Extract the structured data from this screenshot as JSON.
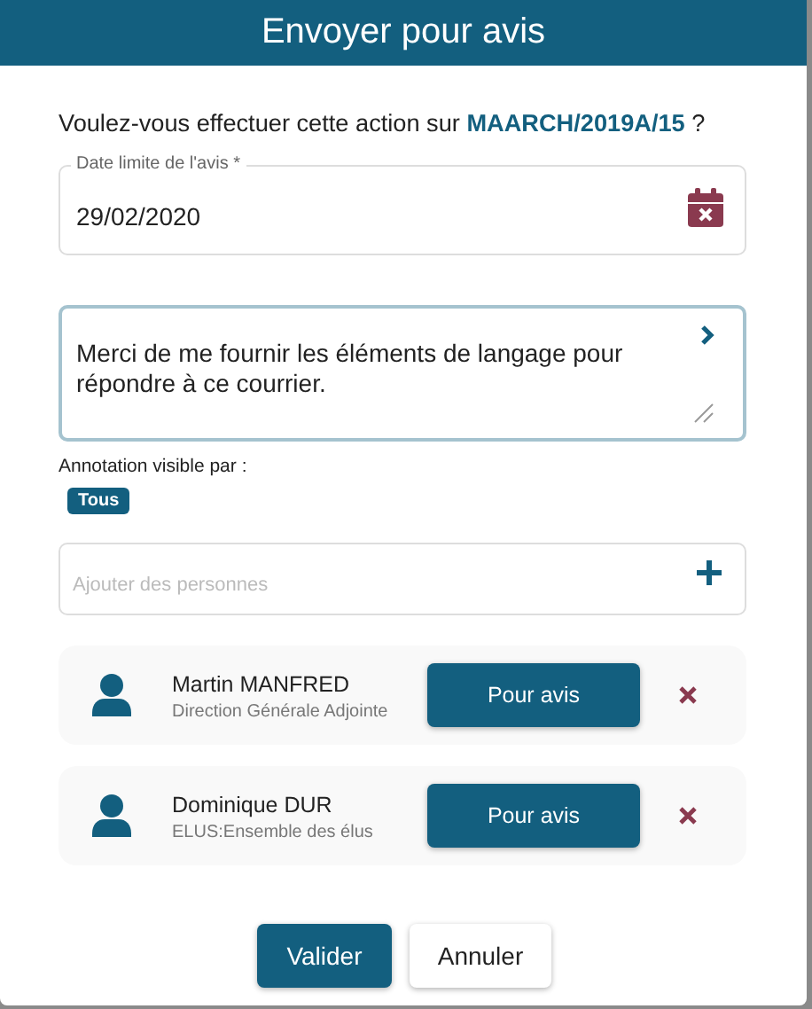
{
  "dialog": {
    "title": "Envoyer pour avis"
  },
  "question": "Voulez-vous effectuer cette action sur **MAARCH/2019A/15** ?",
  "date_field": {
    "label": "Date limite de l'avis *",
    "value": "29/02/2020"
  },
  "note_field": {
    "value": "Merci de me fournir les éléments de langage pour répondre à ce courrier."
  },
  "visibility": {
    "label": "Annotation visible par :",
    "tags": [
      "Tous"
    ]
  },
  "add_field": {
    "placeholder": "Ajouter des personnes"
  },
  "people": [
    {
      "name": "Martin MANFRED",
      "entity": "Direction Générale Adjointe",
      "role": "Pour avis"
    },
    {
      "name": "Dominique DUR",
      "entity": "ELUS:Ensemble des élus",
      "role": "Pour avis"
    }
  ],
  "buttons": [
    {
      "label": "Valider",
      "kind": "primary"
    },
    {
      "label": "Annuler",
      "kind": "secondary"
    }
  ]
}
